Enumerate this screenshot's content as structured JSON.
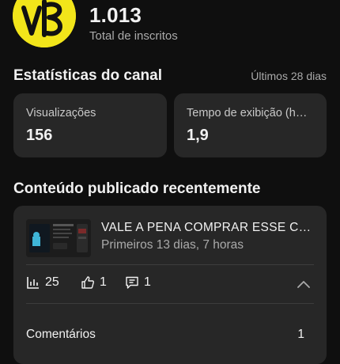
{
  "channel": {
    "avatar_text": "VB",
    "avatar_color": "#f2e51a",
    "subscriber_count": "1.013",
    "subscriber_label": "Total de inscritos"
  },
  "stats": {
    "title": "Estatísticas do canal",
    "range": "Últimos 28 dias",
    "cards": [
      {
        "label": "Visualizações",
        "value": "156"
      },
      {
        "label": "Tempo de exibição (horas)",
        "value": "1,9"
      }
    ]
  },
  "recent": {
    "title": "Conteúdo publicado recentemente",
    "video": {
      "title": "VALE A PENA COMPRAR ESSE CELULAR",
      "meta": "Primeiros 13 dias, 7 horas",
      "views": "25",
      "likes": "1",
      "comments": "1",
      "icons": [
        "bar-chart-icon",
        "thumbs-up-icon",
        "comment-icon",
        "chevron-up-icon"
      ]
    },
    "detail_rows": [
      {
        "label": "Comentários",
        "value": "1"
      }
    ]
  }
}
